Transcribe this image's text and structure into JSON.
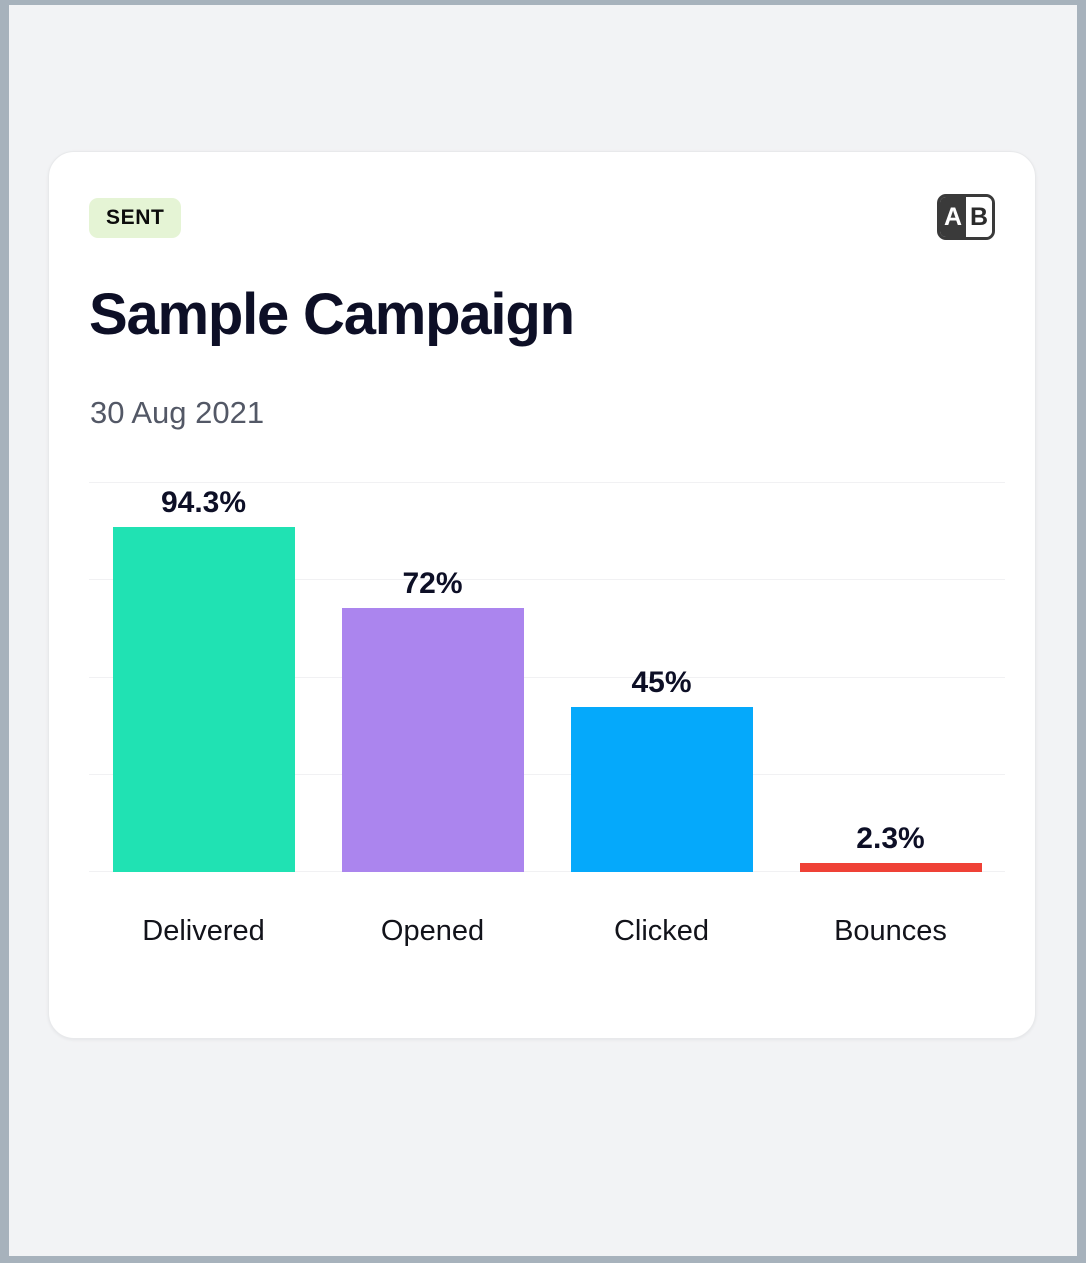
{
  "card": {
    "status_badge": "SENT",
    "ab_icon": {
      "left": "A",
      "right": "B"
    },
    "title": "Sample Campaign",
    "date": "30 Aug 2021"
  },
  "chart_data": {
    "type": "bar",
    "title": "",
    "xlabel": "",
    "ylabel": "",
    "ylim": [
      0,
      100
    ],
    "grid": true,
    "legend": "none",
    "categories": [
      "Delivered",
      "Opened",
      "Clicked",
      "Bounces"
    ],
    "values": [
      94.3,
      72,
      45,
      2.3
    ],
    "value_labels": [
      "94.3%",
      "72%",
      "45%",
      "2.3%"
    ],
    "colors": [
      "#20e2b3",
      "#ab85ee",
      "#05a9fb",
      "#ef4136"
    ]
  },
  "colors": {
    "page_background": "#f2f3f5",
    "page_border": "#a7b2bc",
    "card_background": "#ffffff",
    "badge_background": "#e5f4d5",
    "badge_text": "#0c0c0c",
    "title_text": "#0d0f26",
    "date_text": "#535866",
    "gridline": "#f1f1f3"
  }
}
